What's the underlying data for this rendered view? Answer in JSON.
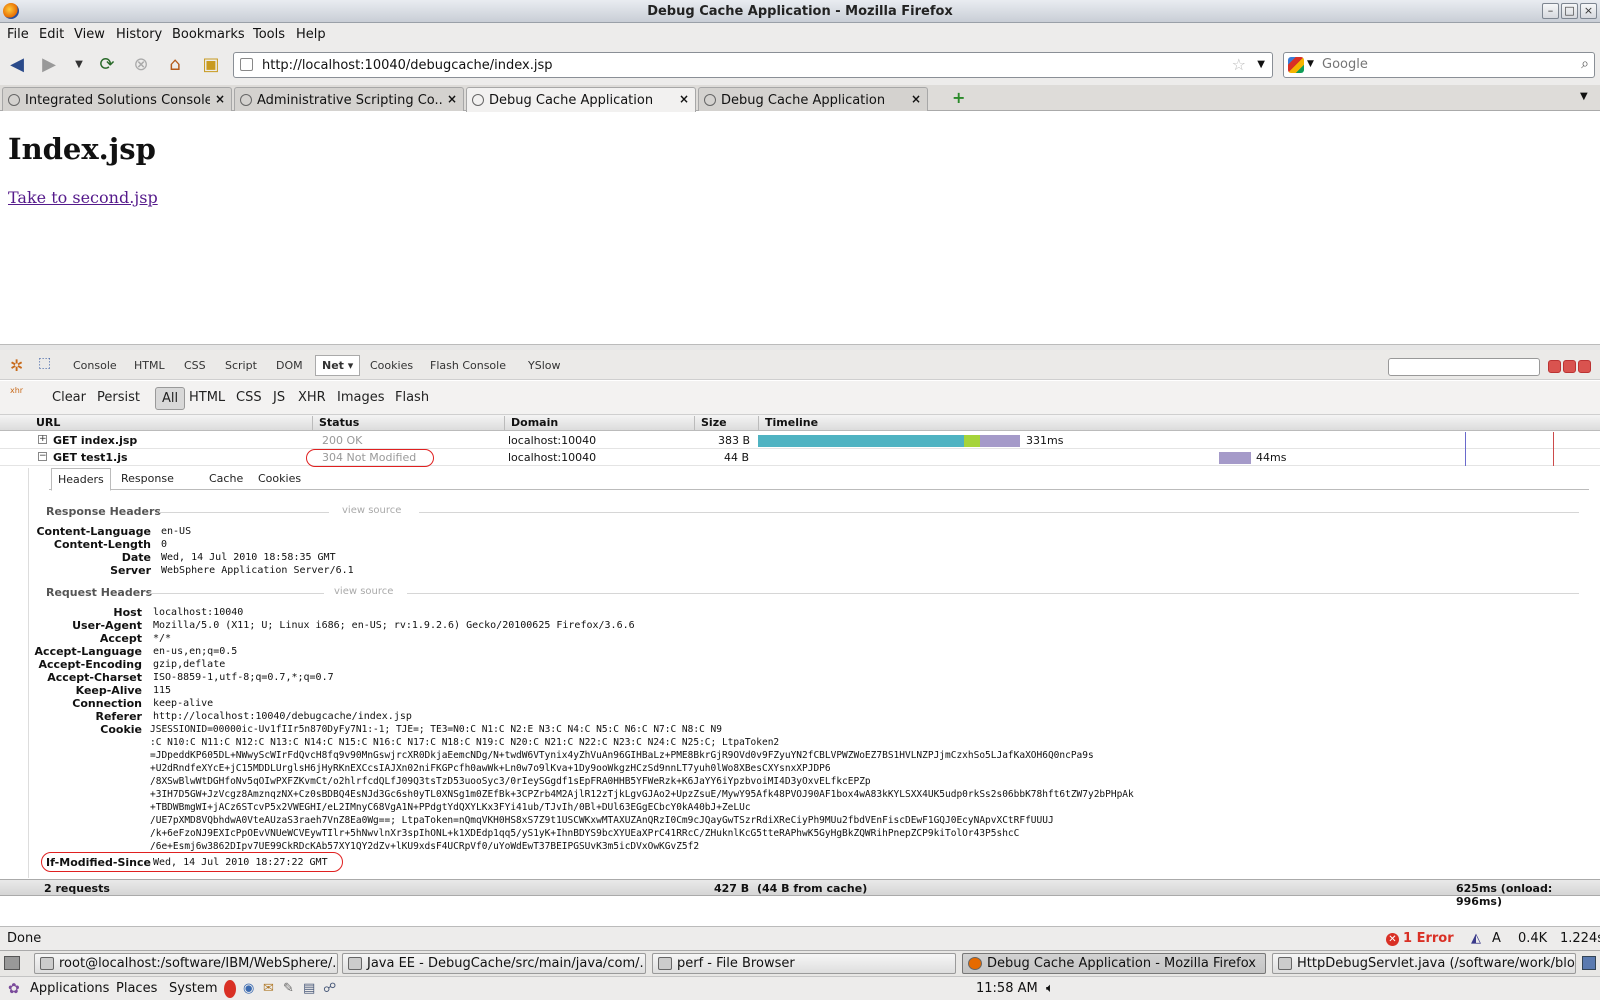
{
  "window": {
    "title": "Debug Cache Application - Mozilla Firefox"
  },
  "menu": [
    "File",
    "Edit",
    "View",
    "History",
    "Bookmarks",
    "Tools",
    "Help"
  ],
  "url": "http://localhost:10040/debugcache/index.jsp",
  "search": {
    "placeholder": "Google"
  },
  "tabs": [
    {
      "label": "Integrated Solutions Console"
    },
    {
      "label": "Administrative Scripting Co..."
    },
    {
      "label": "Debug Cache Application"
    },
    {
      "label": "Debug Cache Application"
    }
  ],
  "page": {
    "heading": "Index.jsp",
    "link": "Take to second.jsp"
  },
  "firebug": {
    "tabs": [
      "Console",
      "HTML",
      "CSS",
      "Script",
      "DOM",
      "Net",
      "Cookies",
      "Flash Console",
      "YSlow"
    ],
    "active_tab": "Net",
    "net_toolbar": [
      "Clear",
      "Persist",
      "All",
      "HTML",
      "CSS",
      "JS",
      "XHR",
      "Images",
      "Flash"
    ],
    "xhr_icon_label": "xhr",
    "columns": [
      "URL",
      "Status",
      "Domain",
      "Size",
      "Timeline"
    ],
    "requests": [
      {
        "url": "GET index.jsp",
        "status": "200 OK",
        "domain": "localhost:10040",
        "size": "383 B",
        "time": "331ms",
        "expander": "+"
      },
      {
        "url": "GET test1.js",
        "status": "304 Not Modified",
        "domain": "localhost:10040",
        "size": "44 B",
        "time": "44ms",
        "expander": "−"
      }
    ],
    "detail_tabs": [
      "Headers",
      "Response",
      "Cache",
      "Cookies"
    ],
    "response_headers": {
      "title": "Response Headers",
      "view_source": "view source",
      "items": [
        {
          "name": "Content-Language",
          "value": "en-US"
        },
        {
          "name": "Content-Length",
          "value": "0"
        },
        {
          "name": "Date",
          "value": "Wed, 14 Jul 2010 18:58:35 GMT"
        },
        {
          "name": "Server",
          "value": "WebSphere Application Server/6.1"
        }
      ]
    },
    "request_headers": {
      "title": "Request Headers",
      "view_source": "view source",
      "items": [
        {
          "name": "Host",
          "value": "localhost:10040"
        },
        {
          "name": "User-Agent",
          "value": "Mozilla/5.0 (X11; U; Linux i686; en-US; rv:1.9.2.6) Gecko/20100625 Firefox/3.6.6"
        },
        {
          "name": "Accept",
          "value": "*/*"
        },
        {
          "name": "Accept-Language",
          "value": "en-us,en;q=0.5"
        },
        {
          "name": "Accept-Encoding",
          "value": "gzip,deflate"
        },
        {
          "name": "Accept-Charset",
          "value": "ISO-8859-1,utf-8;q=0.7,*;q=0.7"
        },
        {
          "name": "Keep-Alive",
          "value": "115"
        },
        {
          "name": "Connection",
          "value": "keep-alive"
        },
        {
          "name": "Referer",
          "value": "http://localhost:10040/debugcache/index.jsp"
        }
      ],
      "cookie_name": "Cookie",
      "cookie_lines": [
        "JSESSIONID=00000ic-Uv1fIIr5n870DyFy7N1:-1; TJE=; TE3=N0:C N1:C N2:E N3:C N4:C N5:C N6:C N7:C N8:C N9",
        ":C N10:C N11:C N12:C N13:C N14:C N15:C N16:C N17:C N18:C N19:C N20:C N21:C N22:C N23:C N24:C N25:C; LtpaToken2",
        "=JDpeddKP605DL+NWwyScWIrFdQvcH8fq9v90MnGswjrcXR0DkjaEemcNDg/N+twdW6VTynix4yZhVuAn96GIHBaLz+PME8BkrGjR9OVd0v9FZyuYN2fCBLVPWZWoEZ7BS1HVLNZPJjmCzxhSo5LJafKaXOH6Q0ncPa9s",
        "+U2dRndfeXYcE+jC15MDDLUrglsH6jHyRKnEXCcsIAJXn02niFKGPcfh0awWk+Ln0w7o9lKva+1Dy9ooWkgzHCzSd9nnLT7yuh0lWo8XBesCXYsnxXPJDP6",
        "/8XSwBlwWtDGHfoNv5qOIwPXFZKvmCt/o2hlrfcdQLfJ09Q3tsTzD53uooSyc3/0rIeySGgdf1sEpFRA0HHB5YFWeRzk+K6JaYY6iYpzbvoiMI4D3yOxvELfkcEPZp",
        "+3IH7D5GW+JzVcgz8AmznqzNX+Cz0sBDBQ4EsNJd3Gc6sh0yTL0XNSg1m0ZEfBk+3CPZrb4M2AjlR12zTjkLgvGJAo2+UpzZsuE/MywY95Afk48PVOJ90AF1box4wA83kKYLSXX4UK5udp0rkSs2s06bbK78hft6tZW7y2bPHpAk",
        "+TBDWBmgWI+jACz6STcvP5x2VWEGHI/eL2IMnyC68VgA1N+PPdgtYdQXYLKx3FYi41ub/TJvIh/0Bl+DUl63EGgECbcY0kA40bJ+ZeLUc",
        "/UE7pXMD8VQbhdwA0VteAUzaS3raeh7VnZ8Ea0Wg==; LtpaToken=nQmqVKH0HS8xS7Z9t1USCWKxwMTAXUZAnQRzI0Cm9cJQayGwTSzrRdiXReCiyPh9MUu2fbdVEnFiscDEwF1GQJ0EcyNApvXCtRFfUUUJ",
        "/k+6eFzoNJ9EXIcPpOEvVNUeWCVEywTIlr+5hNwvlnXr3spIhONL+k1XDEdp1qq5/yS1yK+IhnBDYS9bcXYUEaXPrC41RRcC/ZHuknlKcG5tteRAPhwK5GyHgBkZQWRihPnepZCP9kiTolOr43P5shcC",
        "/6e+Esmj6w3862DIpv7UE99CkRDcKAb57XY1QY2dZv+lKU9xdsF4UCRpVf0/uYoWdEwT37BEIPGSUvK3m5icDVxOwKGvZ5f2"
      ],
      "if_modified_since": {
        "name": "If-Modified-Since",
        "value": "Wed, 14 Jul 2010 18:27:22 GMT"
      }
    },
    "summary": {
      "requests": "2 requests",
      "size": "427 B",
      "cache": "(44 B from cache)",
      "time": "625ms (onload: 996ms)"
    }
  },
  "status": {
    "text": "Done",
    "error": "1 Error",
    "a": "A",
    "size": "0.4K",
    "time": "1.224s"
  },
  "taskbar": [
    {
      "label": "root@localhost:/software/IBM/WebSphere/..."
    },
    {
      "label": "Java EE - DebugCache/src/main/java/com/..."
    },
    {
      "label": "perf - File Browser"
    },
    {
      "label": "Debug Cache Application - Mozilla Firefox"
    },
    {
      "label": "HttpDebugServlet.java (/software/work/blo..."
    }
  ],
  "panel": {
    "applications": "Applications",
    "places": "Places",
    "system": "System",
    "clock": "11:58 AM"
  }
}
